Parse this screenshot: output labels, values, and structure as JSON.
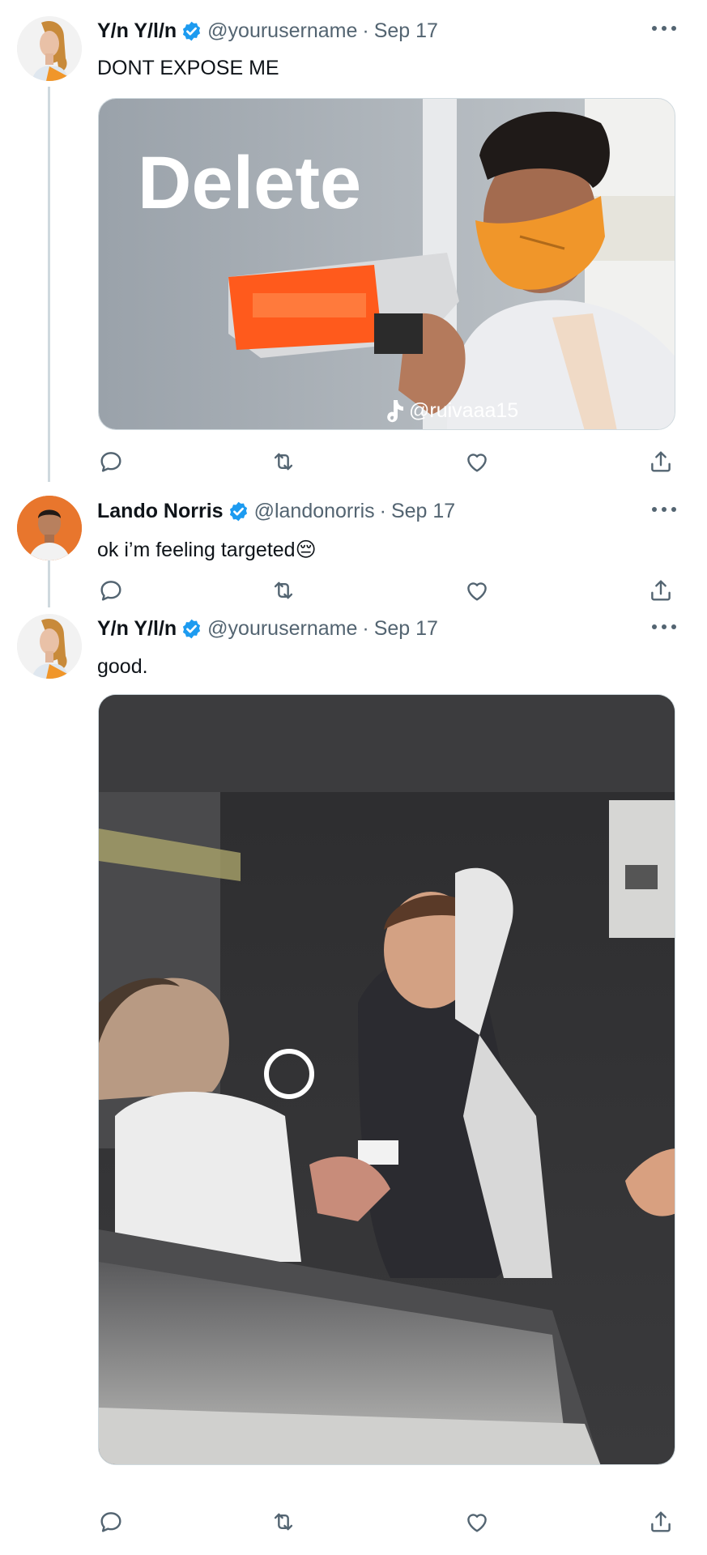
{
  "tweets": [
    {
      "name": "Y/n Y/l/n",
      "handle": "@yourusername",
      "separator": "·",
      "date": "Sep 17",
      "text": "DONT EXPOSE ME",
      "media": {
        "overlay_text": "Delete",
        "watermark": "@ruivaaa15",
        "mask_color": "#f0962a"
      }
    },
    {
      "name": "Lando Norris",
      "handle": "@landonorris",
      "separator": "·",
      "date": "Sep 17",
      "text": "ok i’m feeling targeted😔"
    },
    {
      "name": "Y/n Y/l/n",
      "handle": "@yourusername",
      "separator": "·",
      "date": "Sep 17",
      "text": "good."
    }
  ],
  "colors": {
    "verified": "#1d9bf0",
    "secondary_text": "#536471",
    "thread_line": "#cfd9de",
    "avatar_lando_bg": "#e8762d"
  },
  "icons": [
    "reply-icon",
    "retweet-icon",
    "like-icon",
    "share-icon",
    "more-icon",
    "verified-badge-icon"
  ]
}
